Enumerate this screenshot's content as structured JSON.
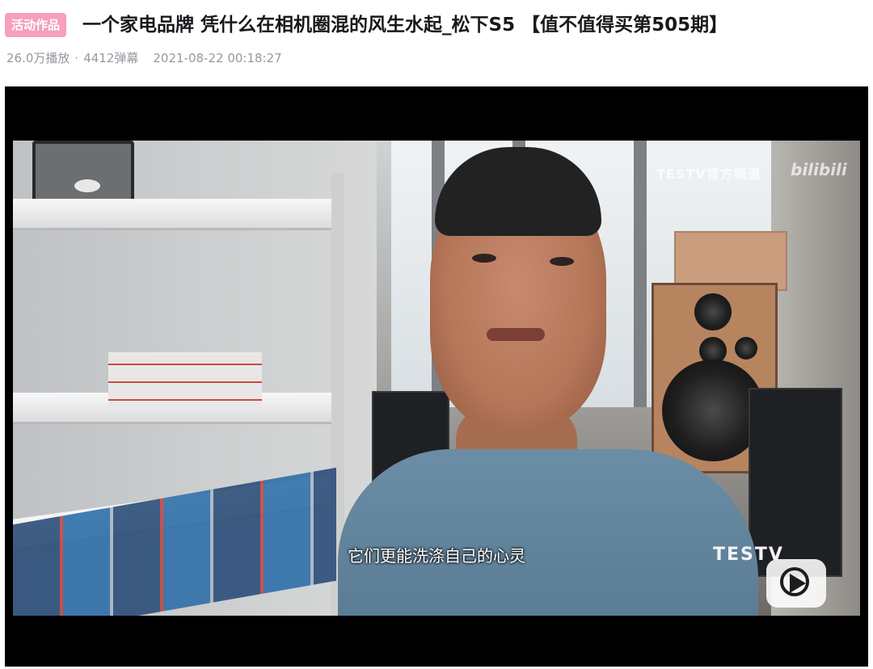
{
  "header": {
    "badge": "活动作品",
    "title": "一个家电品牌 凭什么在相机圈混的风生水起_松下S5 【值不值得买第505期】",
    "views": "26.0万播放",
    "separator": "·",
    "danmaku": "4412弹幕",
    "date": "2021-08-22 00:18:27"
  },
  "player": {
    "watermark": "TESTV官方频道",
    "brand_logo": "bilibili",
    "subtitle": "它们更能洗涤自己的心灵",
    "channel_logo": "TESTV",
    "play_icon": "play-icon"
  },
  "colors": {
    "badge_bg": "#f69fbf",
    "title": "#18191c",
    "meta": "#9499a0",
    "player_bg": "#000000"
  }
}
